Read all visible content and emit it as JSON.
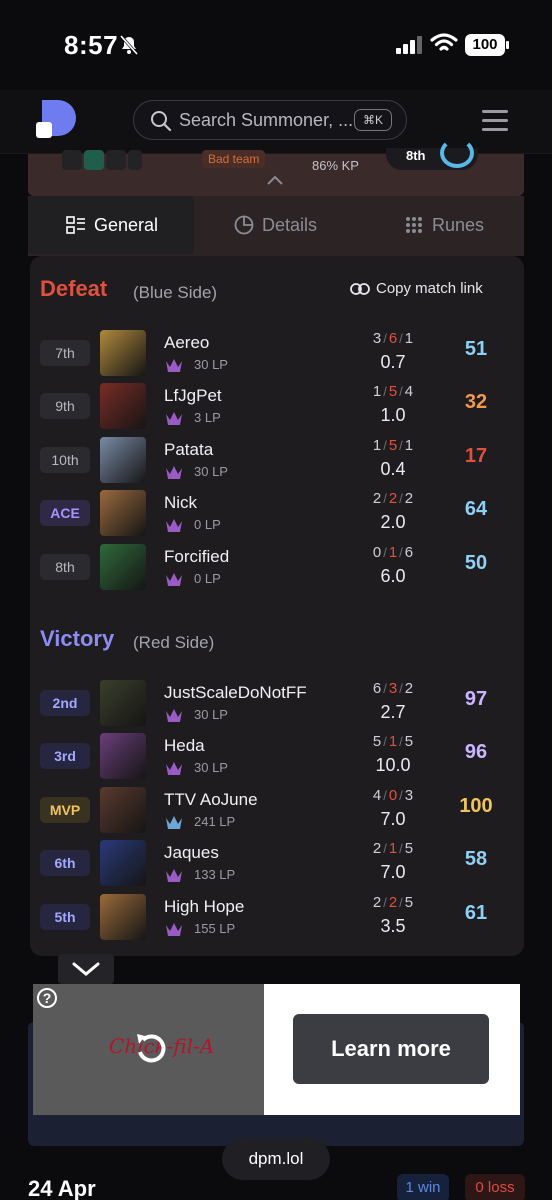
{
  "status_bar": {
    "time": "8:57",
    "battery": "100"
  },
  "header": {
    "search_placeholder": "Search Summoner, ...",
    "shortcut": "⌘K"
  },
  "card_top": {
    "bad_team": "Bad team",
    "kp": "86% KP",
    "rank": "8th"
  },
  "tabs": [
    {
      "label": "General",
      "icon": "general-icon"
    },
    {
      "label": "Details",
      "icon": "pie-chart-icon"
    },
    {
      "label": "Runes",
      "icon": "runes-icon"
    }
  ],
  "colors": {
    "defeat": "#e0503f",
    "victory": "#8d8bf5",
    "background": "#0b0b0d",
    "panel": "#1e1c1f"
  },
  "copy_link": "Copy match link",
  "teams": [
    {
      "result": "Defeat",
      "side": "(Blue Side)",
      "players": [
        {
          "place": "7th",
          "name": "Aereo",
          "lp": "30 LP",
          "k": "3",
          "d": "6",
          "a": "1",
          "ratio": "0.7",
          "score": "51",
          "score_color": "#8fd0f5",
          "portrait": "#b08a3c"
        },
        {
          "place": "9th",
          "name": "LfJgPet",
          "lp": "3 LP",
          "k": "1",
          "d": "5",
          "a": "4",
          "ratio": "1.0",
          "score": "32",
          "score_color": "#f2994a",
          "portrait": "#7a2c26"
        },
        {
          "place": "10th",
          "name": "Patata",
          "lp": "30 LP",
          "k": "1",
          "d": "5",
          "a": "1",
          "ratio": "0.4",
          "score": "17",
          "score_color": "#e0503f",
          "portrait": "#7a8ba6"
        },
        {
          "place": "ACE",
          "name": "Nick",
          "lp": "0 LP",
          "k": "2",
          "d": "2",
          "a": "2",
          "ratio": "2.0",
          "score": "64",
          "score_color": "#8fd0f5",
          "portrait": "#9a6a3e"
        },
        {
          "place": "8th",
          "name": "Forcified",
          "lp": "0 LP",
          "k": "0",
          "d": "1",
          "a": "6",
          "ratio": "6.0",
          "score": "50",
          "score_color": "#8fd0f5",
          "portrait": "#2f6a3a"
        }
      ]
    },
    {
      "result": "Victory",
      "side": "(Red Side)",
      "players": [
        {
          "place": "2nd",
          "name": "JustScaleDoNotFF",
          "lp": "30 LP",
          "k": "6",
          "d": "3",
          "a": "2",
          "ratio": "2.7",
          "score": "97",
          "score_color": "#c9b6ff",
          "portrait": "#3a3f2a"
        },
        {
          "place": "3rd",
          "name": "Heda",
          "lp": "30 LP",
          "k": "5",
          "d": "1",
          "a": "5",
          "ratio": "10.0",
          "score": "96",
          "score_color": "#c9b6ff",
          "portrait": "#6a3f7a"
        },
        {
          "place": "MVP",
          "name": "TTV AoJune",
          "lp": "241 LP",
          "k": "4",
          "d": "0",
          "a": "3",
          "ratio": "7.0",
          "score": "100",
          "score_color": "#f2c559",
          "portrait": "#5a3a2e"
        },
        {
          "place": "6th",
          "name": "Jaques",
          "lp": "133 LP",
          "k": "2",
          "d": "1",
          "a": "5",
          "ratio": "7.0",
          "score": "58",
          "score_color": "#8fd0f5",
          "portrait": "#2a3a7a"
        },
        {
          "place": "5th",
          "name": "High Hope",
          "lp": "155 LP",
          "k": "2",
          "d": "2",
          "a": "5",
          "ratio": "3.5",
          "score": "61",
          "score_color": "#8fd0f5",
          "portrait": "#9a6a3a"
        }
      ]
    }
  ],
  "ad": {
    "brand": "Chick-fil-A",
    "cta": "Learn more"
  },
  "footer": {
    "url": "dpm.lol",
    "date": "24 Apr",
    "wins": "1 win",
    "losses": "0 loss"
  }
}
